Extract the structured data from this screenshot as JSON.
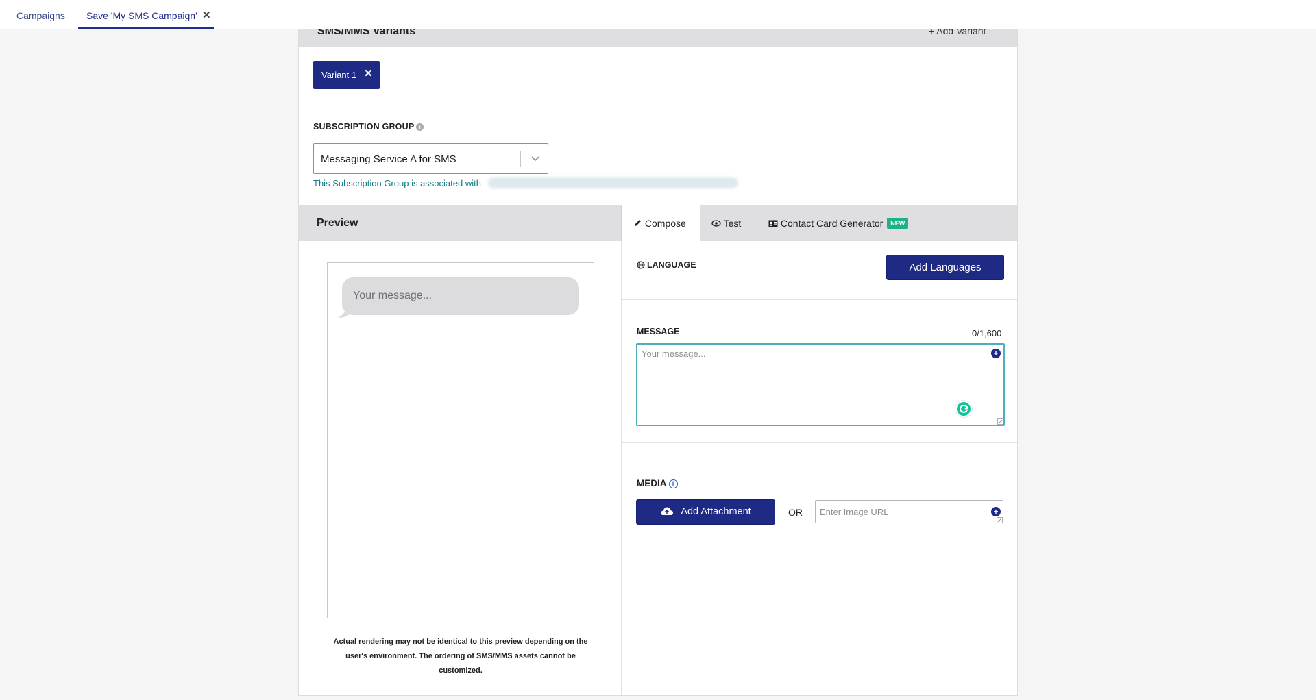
{
  "top_tabs": {
    "campaigns_label": "Campaigns",
    "active_label": "Save 'My SMS Campaign'",
    "close_glyph": "✕"
  },
  "variants": {
    "header_title": "SMS/MMS Variants",
    "add_variant_label": "+ Add Variant",
    "active_variant": "Variant 1",
    "remove_glyph": "✕"
  },
  "subscription": {
    "label": "SUBSCRIPTION GROUP",
    "selected": "Messaging Service A for SMS",
    "assoc_text": "This Subscription Group is associated with"
  },
  "preview": {
    "title": "Preview",
    "bubble_text": "Your message...",
    "disclaimer": "Actual rendering may not be identical to this preview depending on the user's environment. The ordering of SMS/MMS assets cannot be customized."
  },
  "compose_tabs": {
    "compose": "Compose",
    "test": "Test",
    "contact_card": "Contact Card Generator",
    "new_badge": "NEW"
  },
  "language": {
    "label": "LANGUAGE",
    "add_button": "Add Languages"
  },
  "message": {
    "label": "MESSAGE",
    "count": "0/1,600",
    "placeholder": "Your message..."
  },
  "media": {
    "label": "MEDIA",
    "add_attachment": "Add Attachment",
    "or_text": "OR",
    "url_placeholder": "Enter Image URL"
  },
  "colors": {
    "primary": "#1f2a85",
    "accent_teal": "#157d87",
    "new_badge": "#1fb28a",
    "focus_border": "#4cb0bf"
  }
}
